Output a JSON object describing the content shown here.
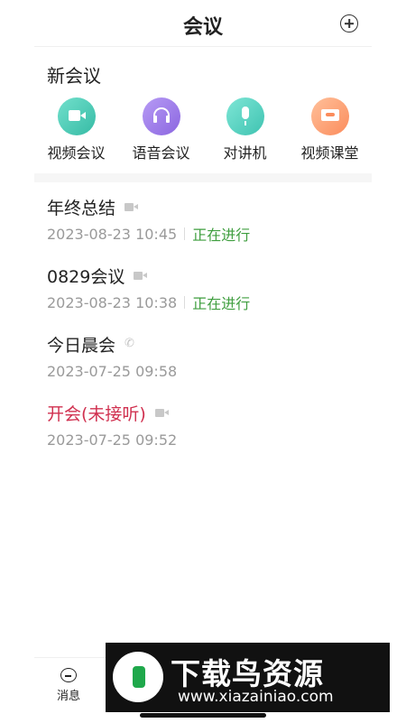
{
  "header": {
    "title": "会议",
    "add_icon": "plus-circle-icon"
  },
  "new_meeting": {
    "title": "新会议",
    "actions": [
      {
        "label": "视频会议",
        "icon": "video-camera-icon",
        "color": "#36bba5"
      },
      {
        "label": "语音会议",
        "icon": "headset-icon",
        "color": "#8b66e0"
      },
      {
        "label": "对讲机",
        "icon": "microphone-icon",
        "color": "#3fc3b1"
      },
      {
        "label": "视频课堂",
        "icon": "screen-share-icon",
        "color": "#fb8c5c"
      }
    ]
  },
  "meetings": [
    {
      "name": "年终总结",
      "type_icon": "video-icon",
      "time": "2023-08-23 10:45",
      "status": "正在进行"
    },
    {
      "name": "0829会议",
      "type_icon": "video-icon",
      "time": "2023-08-23 10:38",
      "status": "正在进行"
    },
    {
      "name": "今日晨会",
      "type_icon": "phone-icon",
      "time": "2023-07-25 09:58",
      "status": ""
    },
    {
      "name": "开会(未接听)",
      "type_icon": "video-icon",
      "time": "2023-07-25 09:52",
      "status": "",
      "missed_color": "#d0304f"
    }
  ],
  "tabbar": {
    "tabs": [
      {
        "label": "消息",
        "icon": "chat-bubble-icon"
      }
    ]
  },
  "watermark": {
    "title": "下载鸟资源",
    "url": "www.xiazainiao.com"
  },
  "colors": {
    "status_green": "#3f9e3f",
    "missed_red": "#d0304f",
    "muted_gray": "#9a9a9a"
  }
}
